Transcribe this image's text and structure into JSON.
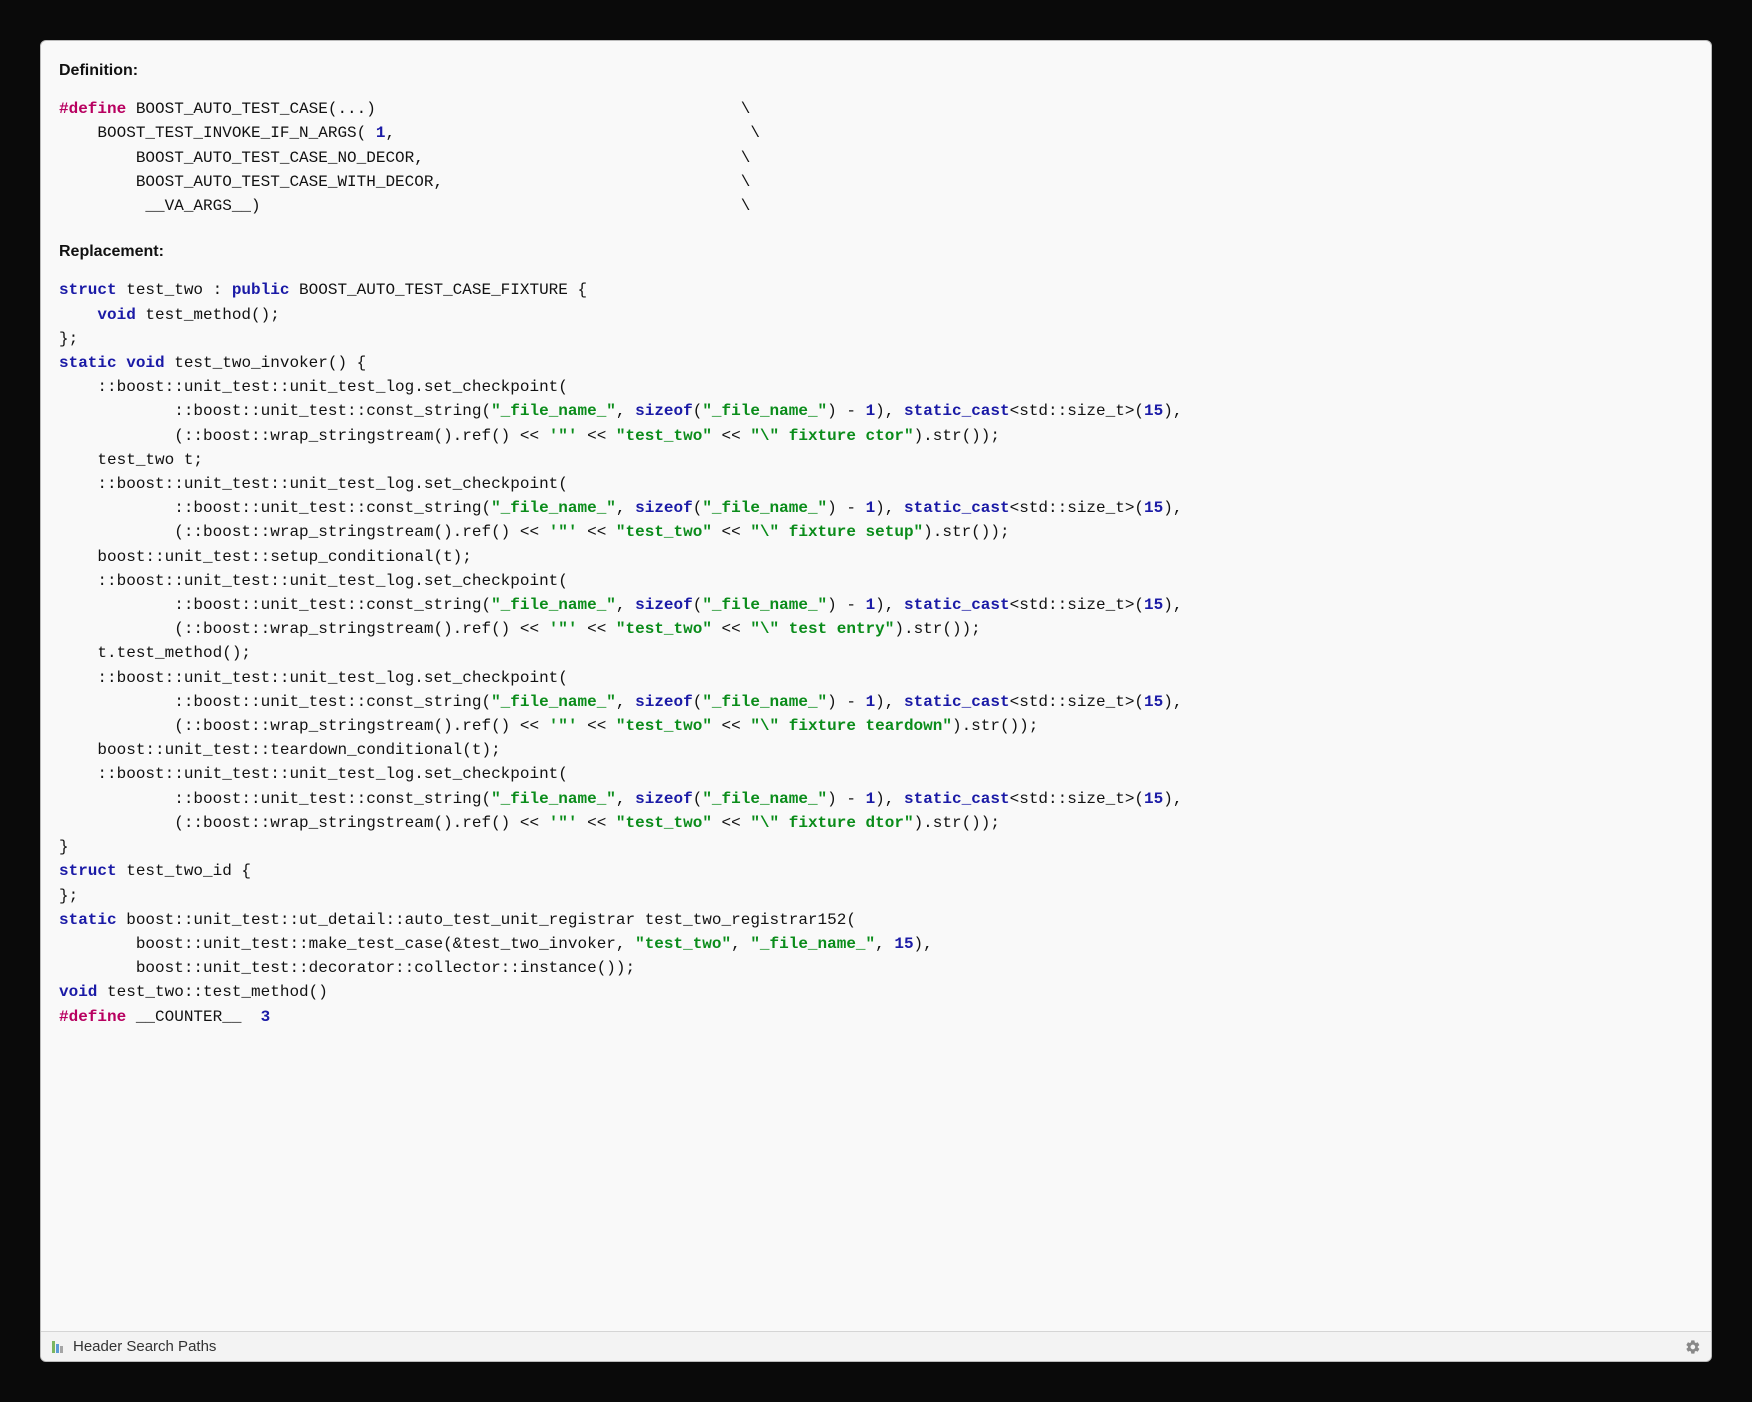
{
  "headings": {
    "definition": "Definition:",
    "replacement": "Replacement:"
  },
  "definition_tokens": [
    [
      [
        "kw",
        "#define"
      ],
      [
        "plain",
        " BOOST_AUTO_TEST_CASE(...)                                      \\"
      ]
    ],
    [
      [
        "plain",
        "    BOOST_TEST_INVOKE_IF_N_ARGS( "
      ],
      [
        "num",
        "1"
      ],
      [
        "plain",
        ",                                     \\"
      ]
    ],
    [
      [
        "plain",
        "        BOOST_AUTO_TEST_CASE_NO_DECOR,                                 \\"
      ]
    ],
    [
      [
        "plain",
        "        BOOST_AUTO_TEST_CASE_WITH_DECOR,                               \\"
      ]
    ],
    [
      [
        "plain",
        "         __VA_ARGS__)                                                  \\"
      ]
    ]
  ],
  "replacement_tokens": [
    [
      [
        "kw2",
        "struct"
      ],
      [
        "plain",
        " test_two : "
      ],
      [
        "kw2",
        "public"
      ],
      [
        "plain",
        " BOOST_AUTO_TEST_CASE_FIXTURE {"
      ]
    ],
    [
      [
        "plain",
        "    "
      ],
      [
        "kw2",
        "void"
      ],
      [
        "plain",
        " test_method();"
      ]
    ],
    [
      [
        "plain",
        "};"
      ]
    ],
    [
      [
        "kw2",
        "static"
      ],
      [
        "plain",
        " "
      ],
      [
        "kw2",
        "void"
      ],
      [
        "plain",
        " test_two_invoker() {"
      ]
    ],
    [
      [
        "plain",
        "    ::boost::unit_test::unit_test_log.set_checkpoint("
      ]
    ],
    [
      [
        "plain",
        "            ::boost::unit_test::const_string("
      ],
      [
        "str",
        "\"_file_name_\""
      ],
      [
        "plain",
        ", "
      ],
      [
        "kw3",
        "sizeof"
      ],
      [
        "plain",
        "("
      ],
      [
        "str",
        "\"_file_name_\""
      ],
      [
        "plain",
        ") - "
      ],
      [
        "num",
        "1"
      ],
      [
        "plain",
        "), "
      ],
      [
        "kw3",
        "static_cast"
      ],
      [
        "plain",
        "<std::size_t>("
      ],
      [
        "num",
        "15"
      ],
      [
        "plain",
        "),"
      ]
    ],
    [
      [
        "plain",
        "            (::boost::wrap_stringstream().ref() << "
      ],
      [
        "str",
        "'\"'"
      ],
      [
        "plain",
        " << "
      ],
      [
        "str",
        "\"test_two\""
      ],
      [
        "plain",
        " << "
      ],
      [
        "str",
        "\"\\\" fixture ctor\""
      ],
      [
        "plain",
        ").str());"
      ]
    ],
    [
      [
        "plain",
        "    test_two t;"
      ]
    ],
    [
      [
        "plain",
        "    ::boost::unit_test::unit_test_log.set_checkpoint("
      ]
    ],
    [
      [
        "plain",
        "            ::boost::unit_test::const_string("
      ],
      [
        "str",
        "\"_file_name_\""
      ],
      [
        "plain",
        ", "
      ],
      [
        "kw3",
        "sizeof"
      ],
      [
        "plain",
        "("
      ],
      [
        "str",
        "\"_file_name_\""
      ],
      [
        "plain",
        ") - "
      ],
      [
        "num",
        "1"
      ],
      [
        "plain",
        "), "
      ],
      [
        "kw3",
        "static_cast"
      ],
      [
        "plain",
        "<std::size_t>("
      ],
      [
        "num",
        "15"
      ],
      [
        "plain",
        "),"
      ]
    ],
    [
      [
        "plain",
        "            (::boost::wrap_stringstream().ref() << "
      ],
      [
        "str",
        "'\"'"
      ],
      [
        "plain",
        " << "
      ],
      [
        "str",
        "\"test_two\""
      ],
      [
        "plain",
        " << "
      ],
      [
        "str",
        "\"\\\" fixture setup\""
      ],
      [
        "plain",
        ").str());"
      ]
    ],
    [
      [
        "plain",
        "    boost::unit_test::setup_conditional(t);"
      ]
    ],
    [
      [
        "plain",
        "    ::boost::unit_test::unit_test_log.set_checkpoint("
      ]
    ],
    [
      [
        "plain",
        "            ::boost::unit_test::const_string("
      ],
      [
        "str",
        "\"_file_name_\""
      ],
      [
        "plain",
        ", "
      ],
      [
        "kw3",
        "sizeof"
      ],
      [
        "plain",
        "("
      ],
      [
        "str",
        "\"_file_name_\""
      ],
      [
        "plain",
        ") - "
      ],
      [
        "num",
        "1"
      ],
      [
        "plain",
        "), "
      ],
      [
        "kw3",
        "static_cast"
      ],
      [
        "plain",
        "<std::size_t>("
      ],
      [
        "num",
        "15"
      ],
      [
        "plain",
        "),"
      ]
    ],
    [
      [
        "plain",
        "            (::boost::wrap_stringstream().ref() << "
      ],
      [
        "str",
        "'\"'"
      ],
      [
        "plain",
        " << "
      ],
      [
        "str",
        "\"test_two\""
      ],
      [
        "plain",
        " << "
      ],
      [
        "str",
        "\"\\\" test entry\""
      ],
      [
        "plain",
        ").str());"
      ]
    ],
    [
      [
        "plain",
        "    t.test_method();"
      ]
    ],
    [
      [
        "plain",
        "    ::boost::unit_test::unit_test_log.set_checkpoint("
      ]
    ],
    [
      [
        "plain",
        "            ::boost::unit_test::const_string("
      ],
      [
        "str",
        "\"_file_name_\""
      ],
      [
        "plain",
        ", "
      ],
      [
        "kw3",
        "sizeof"
      ],
      [
        "plain",
        "("
      ],
      [
        "str",
        "\"_file_name_\""
      ],
      [
        "plain",
        ") - "
      ],
      [
        "num",
        "1"
      ],
      [
        "plain",
        "), "
      ],
      [
        "kw3",
        "static_cast"
      ],
      [
        "plain",
        "<std::size_t>("
      ],
      [
        "num",
        "15"
      ],
      [
        "plain",
        "),"
      ]
    ],
    [
      [
        "plain",
        "            (::boost::wrap_stringstream().ref() << "
      ],
      [
        "str",
        "'\"'"
      ],
      [
        "plain",
        " << "
      ],
      [
        "str",
        "\"test_two\""
      ],
      [
        "plain",
        " << "
      ],
      [
        "str",
        "\"\\\" fixture teardown\""
      ],
      [
        "plain",
        ").str());"
      ]
    ],
    [
      [
        "plain",
        "    boost::unit_test::teardown_conditional(t);"
      ]
    ],
    [
      [
        "plain",
        "    ::boost::unit_test::unit_test_log.set_checkpoint("
      ]
    ],
    [
      [
        "plain",
        "            ::boost::unit_test::const_string("
      ],
      [
        "str",
        "\"_file_name_\""
      ],
      [
        "plain",
        ", "
      ],
      [
        "kw3",
        "sizeof"
      ],
      [
        "plain",
        "("
      ],
      [
        "str",
        "\"_file_name_\""
      ],
      [
        "plain",
        ") - "
      ],
      [
        "num",
        "1"
      ],
      [
        "plain",
        "), "
      ],
      [
        "kw3",
        "static_cast"
      ],
      [
        "plain",
        "<std::size_t>("
      ],
      [
        "num",
        "15"
      ],
      [
        "plain",
        "),"
      ]
    ],
    [
      [
        "plain",
        "            (::boost::wrap_stringstream().ref() << "
      ],
      [
        "str",
        "'\"'"
      ],
      [
        "plain",
        " << "
      ],
      [
        "str",
        "\"test_two\""
      ],
      [
        "plain",
        " << "
      ],
      [
        "str",
        "\"\\\" fixture dtor\""
      ],
      [
        "plain",
        ").str());"
      ]
    ],
    [
      [
        "plain",
        "}"
      ]
    ],
    [
      [
        "kw2",
        "struct"
      ],
      [
        "plain",
        " test_two_id {"
      ]
    ],
    [
      [
        "plain",
        "};"
      ]
    ],
    [
      [
        "kw2",
        "static"
      ],
      [
        "plain",
        " boost::unit_test::ut_detail::auto_test_unit_registrar test_two_registrar152("
      ]
    ],
    [
      [
        "plain",
        "        boost::unit_test::make_test_case(&test_two_invoker, "
      ],
      [
        "str",
        "\"test_two\""
      ],
      [
        "plain",
        ", "
      ],
      [
        "str",
        "\"_file_name_\""
      ],
      [
        "plain",
        ", "
      ],
      [
        "num",
        "15"
      ],
      [
        "plain",
        "),"
      ]
    ],
    [
      [
        "plain",
        "        boost::unit_test::decorator::collector::instance());"
      ]
    ],
    [
      [
        "kw2",
        "void"
      ],
      [
        "plain",
        " test_two::test_method()"
      ]
    ],
    [
      [
        "kw",
        "#define"
      ],
      [
        "plain",
        " __COUNTER__  "
      ],
      [
        "num",
        "3"
      ]
    ]
  ],
  "footer": {
    "label": "Header Search Paths"
  }
}
